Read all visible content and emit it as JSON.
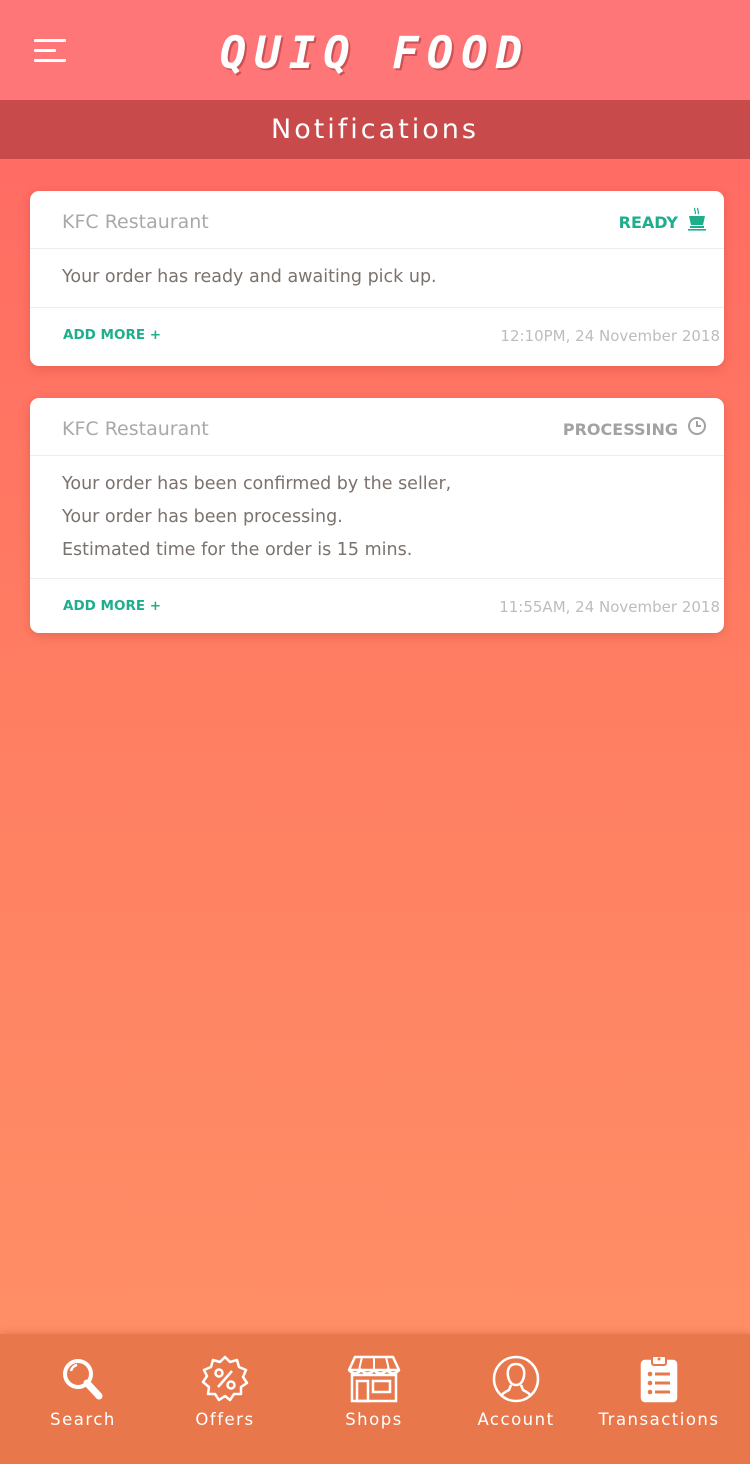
{
  "header": {
    "app_title": "QUIQ FOOD",
    "page_title": "Notifications"
  },
  "notifications": [
    {
      "shop": "KFC Restaurant",
      "status": "READY",
      "status_icon": "coffee-cup-icon",
      "message_lines": [
        "Your order has ready and awaiting pick up."
      ],
      "add_more": "ADD MORE +",
      "time": "12:10PM, 24 November 2018"
    },
    {
      "shop": "KFC Restaurant",
      "status": "PROCESSING",
      "status_icon": "clock-icon",
      "message_lines": [
        "Your order has been confirmed by the seller,",
        "Your order has been processing.",
        "Estimated time for the order is 15 mins."
      ],
      "add_more": "ADD MORE +",
      "time": "11:55AM, 24 November 2018"
    }
  ],
  "bottom_nav": [
    {
      "label": "Search",
      "icon": "search-icon"
    },
    {
      "label": "Offers",
      "icon": "offers-percent-icon"
    },
    {
      "label": "Shops",
      "icon": "shop-icon"
    },
    {
      "label": "Account",
      "icon": "account-icon"
    },
    {
      "label": "Transactions",
      "icon": "clipboard-list-icon"
    }
  ],
  "colors": {
    "topbar": "#ff7679",
    "subbar": "#c94a4b",
    "accent_green": "#1fae8b",
    "bottom_nav": "#e8784c"
  }
}
